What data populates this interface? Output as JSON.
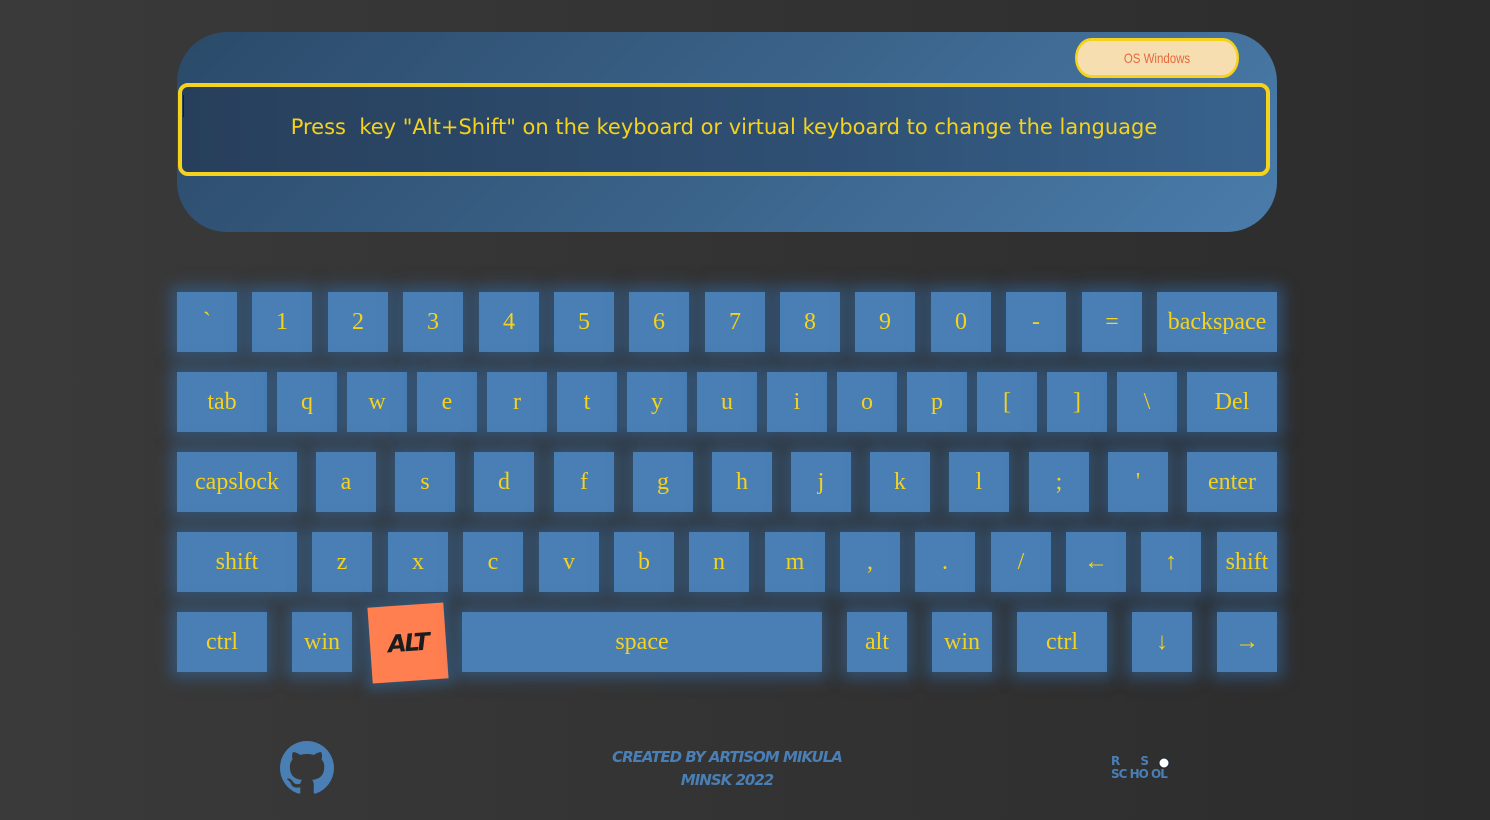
{
  "os_badge": "OS Windows",
  "instruction": "Press  key \"Alt+Shift\" on the keyboard or virtual keyboard to change the language",
  "keyboard": {
    "rows": [
      [
        "`",
        "1",
        "2",
        "3",
        "4",
        "5",
        "6",
        "7",
        "8",
        "9",
        "0",
        "-",
        "=",
        "backspace"
      ],
      [
        "tab",
        "q",
        "w",
        "e",
        "r",
        "t",
        "y",
        "u",
        "i",
        "o",
        "p",
        "[",
        "]",
        "\\",
        "Del"
      ],
      [
        "capslock",
        "a",
        "s",
        "d",
        "f",
        "g",
        "h",
        "j",
        "k",
        "l",
        ";",
        "'",
        "enter"
      ],
      [
        "shift",
        "z",
        "x",
        "c",
        "v",
        "b",
        "n",
        "m",
        ",",
        ".",
        "/",
        "←",
        "↑",
        "shift"
      ],
      [
        "ctrl",
        "win",
        "ALT",
        "space",
        "alt",
        "win",
        "ctrl",
        "↓",
        "→"
      ]
    ],
    "pressed_key": "ALT"
  },
  "footer": {
    "credit_line1": "Created by Artisom Mikula",
    "credit_line2": "Minsk 2022",
    "logo_text_top": "R S",
    "logo_text_bottom": "SC HO OL"
  },
  "colors": {
    "accent": "#f5d21b",
    "key_bg": "#4a7fb5",
    "pressed_bg": "#ff7f50",
    "badge_text": "#e8683f"
  }
}
